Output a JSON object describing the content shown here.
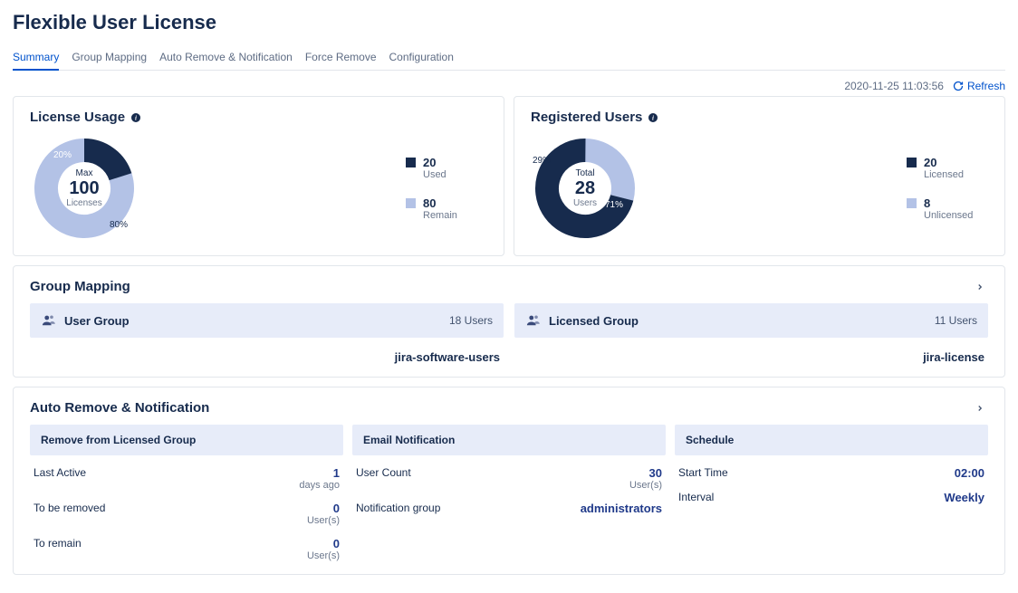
{
  "page_title": "Flexible User License",
  "tabs": {
    "summary": "Summary",
    "group_mapping": "Group Mapping",
    "auto_remove": "Auto Remove & Notification",
    "force_remove": "Force Remove",
    "configuration": "Configuration",
    "active": "summary"
  },
  "timestamp": "2020-11-25 11:03:56",
  "refresh_label": "Refresh",
  "license_usage": {
    "title": "License Usage",
    "center_label": "Max",
    "center_value": "100",
    "center_sub": "Licenses",
    "pct_used": "20%",
    "pct_remain": "80%",
    "legend": {
      "used_value": "20",
      "used_label": "Used",
      "remain_value": "80",
      "remain_label": "Remain"
    }
  },
  "registered_users": {
    "title": "Registered Users",
    "center_label": "Total",
    "center_value": "28",
    "center_sub": "Users",
    "pct_licensed": "71%",
    "pct_unlicensed": "29%",
    "legend": {
      "licensed_value": "20",
      "licensed_label": "Licensed",
      "unlicensed_value": "8",
      "unlicensed_label": "Unlicensed"
    }
  },
  "group_mapping_section": {
    "title": "Group Mapping",
    "user_group": {
      "label": "User Group",
      "count": "18 Users",
      "value": "jira-software-users"
    },
    "licensed_group": {
      "label": "Licensed Group",
      "count": "11 Users",
      "value": "jira-license"
    }
  },
  "auto_section": {
    "title": "Auto Remove & Notification",
    "remove": {
      "header": "Remove from Licensed Group",
      "last_active_label": "Last Active",
      "last_active_value": "1",
      "last_active_unit": "days ago",
      "to_be_removed_label": "To be removed",
      "to_be_removed_value": "0",
      "to_be_removed_unit": "User(s)",
      "to_remain_label": "To remain",
      "to_remain_value": "0",
      "to_remain_unit": "User(s)"
    },
    "email": {
      "header": "Email Notification",
      "user_count_label": "User Count",
      "user_count_value": "30",
      "user_count_unit": "User(s)",
      "notif_group_label": "Notification group",
      "notif_group_value": "administrators"
    },
    "schedule": {
      "header": "Schedule",
      "start_time_label": "Start Time",
      "start_time_value": "02:00",
      "interval_label": "Interval",
      "interval_value": "Weekly"
    }
  },
  "colors": {
    "dark": "#172b4d",
    "light": "#b3c2e6"
  },
  "chart_data": [
    {
      "type": "pie",
      "title": "License Usage",
      "series": [
        {
          "name": "Used",
          "value": 20,
          "pct": 20
        },
        {
          "name": "Remain",
          "value": 80,
          "pct": 80
        }
      ],
      "center": {
        "label": "Max",
        "value": 100,
        "unit": "Licenses"
      }
    },
    {
      "type": "pie",
      "title": "Registered Users",
      "series": [
        {
          "name": "Licensed",
          "value": 20,
          "pct": 71
        },
        {
          "name": "Unlicensed",
          "value": 8,
          "pct": 29
        }
      ],
      "center": {
        "label": "Total",
        "value": 28,
        "unit": "Users"
      }
    }
  ]
}
